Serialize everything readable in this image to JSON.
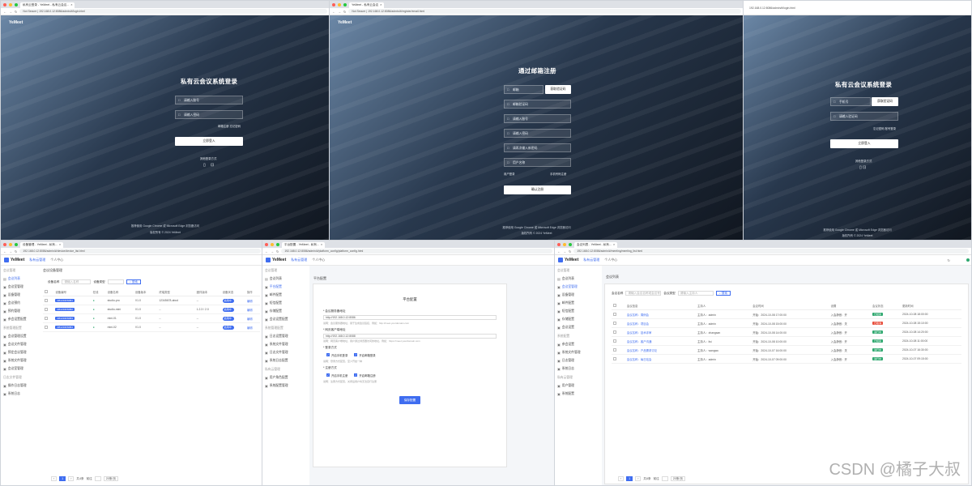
{
  "colors": {
    "accent": "#3f6df0",
    "login_bg_dark": "#10161f",
    "login_bg_light": "#6b87a6",
    "tag_red": "#e84f3d",
    "tag_green": "#2fa86f",
    "tag_dark": "#2b3440"
  },
  "login1": {
    "tab": "私有云登录 - YeMeet - 私有云会议...",
    "secure": "Not Secure",
    "url": "192.168.0.12:8086/admin/#/login.html",
    "brand": "YeMeet",
    "title": "私有云会议系统登录",
    "user_ph": "请输入账号",
    "pwd_ph": "请输入密码",
    "links": "邮箱注册  忘记密码",
    "login_btn": "立即登入",
    "other_label": "其他登录方式",
    "footer1": "推荐使用 Google Chrome 或 Microsoft Edge 浏览器访问",
    "footer2": "版权所有 © 2024 YeMeet"
  },
  "register": {
    "tab": "YeMeet - 私有云会议",
    "secure": "Not Secure",
    "url": "192.168.0.12:8086/admin/#/register/email.html",
    "brand": "YeMeet",
    "title": "通过邮箱注册",
    "email_ph": "邮箱",
    "code_btn": "获取验证码",
    "code_ph": "邮箱验证码",
    "user_ph": "请输入账号",
    "pwd_ph": "请输入密码",
    "pwd2_ph": "请再次输入新密码",
    "name_ph": "用户名称",
    "left_link": "用户登录",
    "right_link": "手机号码注册",
    "submit": "确认注册",
    "footer1": "推荐使用 Google Chrome 或 Microsoft Edge 浏览器访问",
    "footer2": "版权所有 © 2024 YeMeet"
  },
  "login2": {
    "url": "192.168.0.12:8086/admin/#/login.html",
    "title": "私有云会议系统登录",
    "phone_ph": "手机号",
    "code_btn": "获取验证码",
    "code_ph": "请输入验证码",
    "links": "忘记密码  账号登录",
    "login_btn": "立即登入",
    "other_label": "其他登录方式",
    "footer1": "推荐使用 Google Chrome 或 Microsoft Edge 浏览器访问",
    "footer2": "版权所有 © 2024 YeMeet"
  },
  "admin": {
    "logo": "YeMeet",
    "nav_active": "私有云管理",
    "nav_other": "个人中心",
    "menu_group1": "会议管理",
    "menu_group2": "系统管理配置",
    "menu_group3": "日志文件管理",
    "menu_group4": "私有云管理"
  },
  "devices": {
    "tab": "设备管理 - YeMeet - 私有...",
    "url": "192.168.0.12:8086/admin/#/device/device_list.html",
    "breadcrumb": "会议设备管理",
    "search_label1": "设备名称",
    "search_ph": "请输入名称",
    "search_label2": "设备类型",
    "search_btn": "搜索",
    "menu": [
      "会议列表",
      "会议室管理",
      "设备管理",
      "会议预约",
      "预约管理",
      "参会设置配置",
      "会议管理设置",
      "会议文件管理",
      "预定会议管理",
      "系统文件管理",
      "会议室管理",
      "操作日志管理",
      "系统日志"
    ],
    "columns": [
      "设备编号",
      "在线",
      "设备名称",
      "设备版本",
      "终端类型",
      "固件版本",
      "设备状态",
      "操作"
    ],
    "rows": [
      [
        "AB1234F60B1",
        "●",
        "studio-pro",
        "V1.0",
        "12345678-abcd",
        "--",
        "启用中",
        "编辑"
      ],
      [
        "AB1234F60B2",
        "●",
        "studio-mini",
        "V1.0",
        "--",
        "1.2.3 / 2.0",
        "启用中",
        "编辑"
      ],
      [
        "AB1234F60B3",
        "●",
        "mini-01",
        "V1.0",
        "--",
        "--",
        "启用中",
        "编辑"
      ],
      [
        "AB1234F60B4",
        "●",
        "mini-02",
        "V1.0",
        "--",
        "--",
        "启用中",
        "编辑"
      ]
    ],
    "pager": {
      "total": "共4条",
      "page": "1",
      "goto": "前往",
      "size": "20条/页"
    }
  },
  "platform": {
    "tab": "平台配置 - YeMeet - 私有...",
    "url": "192.168.0.12:8086/admin/#/platform_config/platform_config.html",
    "breadcrumb": "平台配置",
    "menu": [
      "会议管理",
      "会议列表",
      "平台配置",
      "邮件配置",
      "短信配置",
      "存储配置",
      "会议设置配置",
      "系统管理配置",
      "日志设置管理",
      "系统文件管理",
      "日志文件管理",
      "系统日志配置",
      "用户角色配置",
      "系统配置管理"
    ],
    "card_title": "平台配置",
    "f1_label": "* 会议服务器地址",
    "f1_value": "http://192.168.0.12:8086",
    "f1_help": "说明：会议服务器地址，用于生成会议链接，例如：http://meet.yourdomain.com",
    "f2_label": "* 网页客户端地址",
    "f2_value": "http://192.168.0.12:8088",
    "f2_help": "说明：网页客户端地址，用户通过浏览器访问的地址，例如：https://meet.yourdomain.com",
    "f3_label": "* 登录方式",
    "f3_opt1": "开启手机登录",
    "f3_opt2": "开启邮箱登录",
    "f3_help": "说明：登录方式配置，至少开启一种",
    "f4_label": "* 注册方式",
    "f4_opt1": "开启手机注册",
    "f4_opt2": "开启邮箱注册",
    "f4_help": "说明：注册方式配置，关闭后用户将无法自行注册",
    "save": "保存配置"
  },
  "meetings": {
    "tab": "会议列表 - YeMeet - 私有...",
    "url": "192.168.0.12:8086/admin/#/meeting/meeting_list.html",
    "breadcrumb": "会议列表",
    "search_label": "会议名称",
    "search_ph": "请输入会议名称或会议号",
    "search_label2": "会议类型",
    "search_ph2": "请输入主持人",
    "search_btn": "搜索",
    "menu": [
      "会议管理",
      "会议列表",
      "会议室管理",
      "设备管理",
      "邮件配置",
      "短信配置",
      "存储配置",
      "会议设置",
      "系统配置",
      "参会设置",
      "系统文件管理",
      "日志管理",
      "系统日志",
      "用户管理",
      "系统配置"
    ],
    "columns": [
      "会议信息",
      "主持人",
      "会议时间",
      "设置",
      "会议状态",
      "更新时间"
    ],
    "rows": [
      [
        "会议名称：周例会",
        "主持人：admin",
        "开始：2024-10-08 17:00:00",
        "入会静音：开",
        "已结束",
        "2024-10-08 18:00:00"
      ],
      [
        "会议名称：项目会",
        "主持人：admin",
        "开始：2024-10-08 15:00:00",
        "入会静音：关",
        "已取消",
        "2024-10-08 15:10:00"
      ],
      [
        "会议名称：技术评审",
        "主持人：zhangsan",
        "开始：2024-10-08 14:00:00",
        "入会静音：开",
        "进行中",
        "2024-10-08 14:20:00"
      ],
      [
        "会议名称：客户沟通",
        "主持人：lisi",
        "开始：2024-10-08 10:00:00",
        "入会静音：开",
        "已结束",
        "2024-10-08 11:00:00"
      ],
      [
        "会议名称：产品需求讨论",
        "主持人：wangwu",
        "开始：2024-10-07 16:00:00",
        "入会静音：关",
        "进行中",
        "2024-10-07 16:30:00"
      ],
      [
        "会议名称：每日站会",
        "主持人：admin",
        "开始：2024-10-07 09:00:00",
        "入会静音：开",
        "进行中",
        "2024-10-07 09:15:00"
      ]
    ],
    "pager": {
      "total": "共6条",
      "page": "1",
      "goto": "前往",
      "size": "20条/页"
    }
  },
  "watermark": "CSDN @橘子大叔"
}
